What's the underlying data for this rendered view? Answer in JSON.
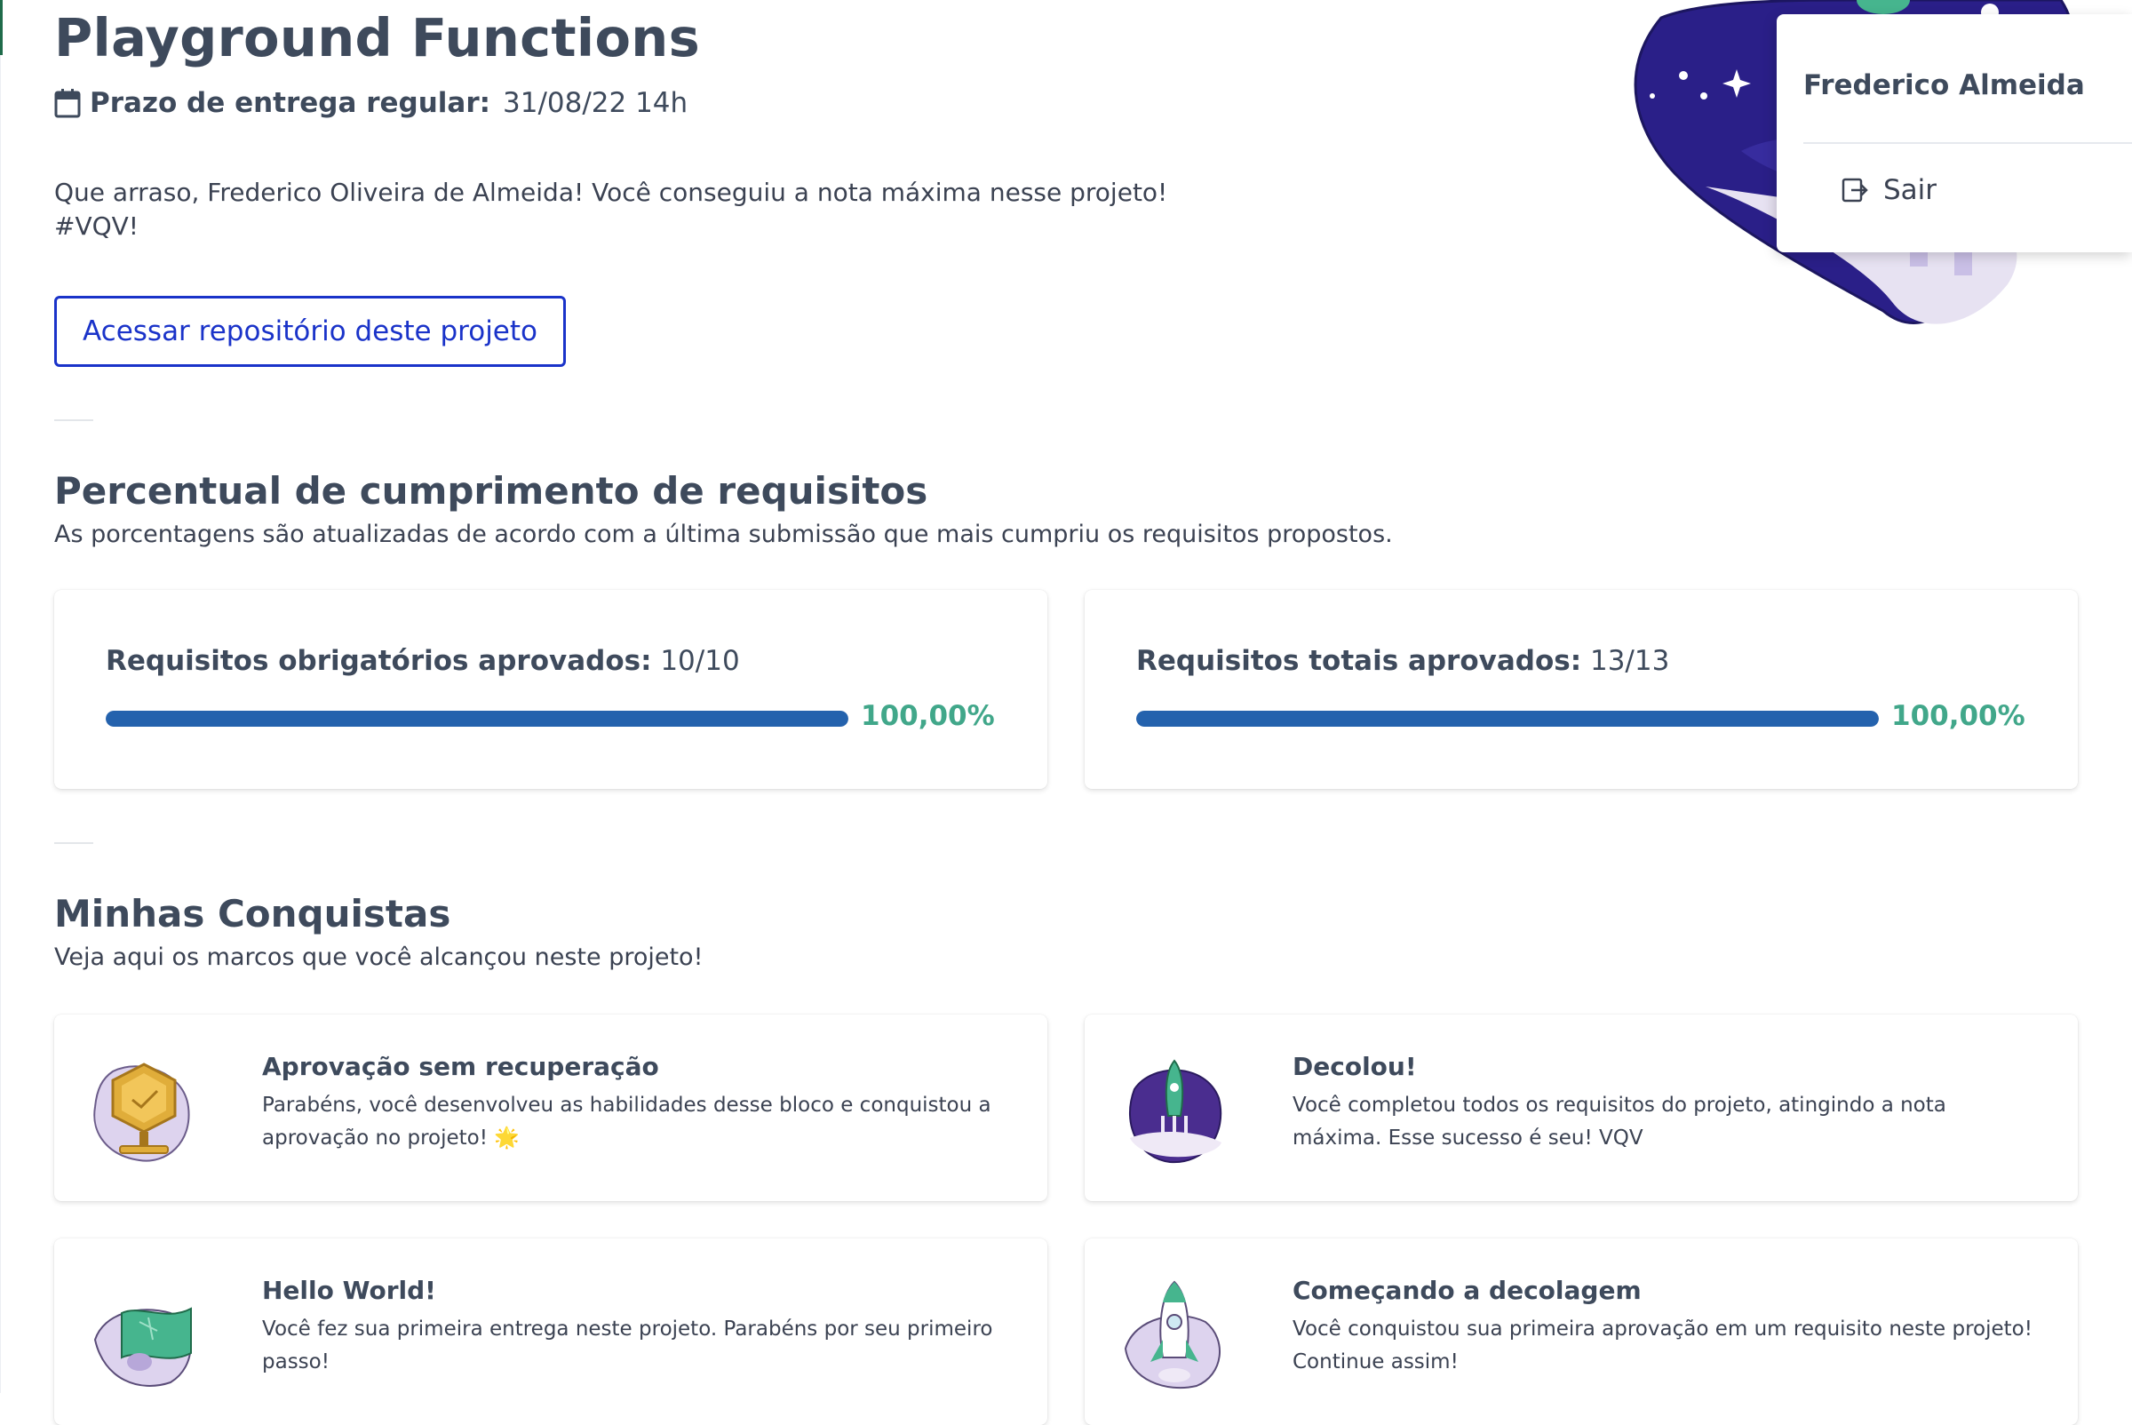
{
  "project": {
    "title": "Playground Functions",
    "deadline_label": "Prazo de entrega regular:",
    "deadline_value": "31/08/22 14h",
    "congrats_line1": "Que arraso, Frederico Oliveira de Almeida! Você conseguiu a nota máxima nesse projeto!",
    "congrats_line2": "#VQV!",
    "repo_button": "Acessar repositório deste projeto"
  },
  "user_menu": {
    "name": "Frederico Almeida",
    "logout_label": "Sair"
  },
  "requirements": {
    "title": "Percentual de cumprimento de requisitos",
    "subtitle": "As porcentagens são atualizadas de acordo com a última submissão que mais cumpriu os requisitos propostos.",
    "cards": [
      {
        "label": "Requisitos obrigatórios aprovados:",
        "value": "10/10",
        "percent_text": "100,00%",
        "progress": 1.0
      },
      {
        "label": "Requisitos totais aprovados:",
        "value": "13/13",
        "percent_text": "100,00%",
        "progress": 1.0
      }
    ]
  },
  "achievements": {
    "title": "Minhas Conquistas",
    "subtitle": "Veja aqui os marcos que você alcançou neste projeto!",
    "items": [
      {
        "title": "Aprovação sem recuperação",
        "description": "Parabéns, você desenvolveu as habilidades desse bloco e conquistou a aprovação no projeto! 🌟",
        "icon": "trophy-icon"
      },
      {
        "title": "Decolou!",
        "description": "Você completou todos os requisitos do projeto, atingindo a nota máxima. Esse sucesso é seu! VQV",
        "icon": "rocket-launch-icon"
      },
      {
        "title": "Hello World!",
        "description": "Você fez sua primeira entrega neste projeto. Parabéns por seu primeiro passo!",
        "icon": "flag-icon"
      },
      {
        "title": "Começando a decolagem",
        "description": "Você conquistou sua primeira aprovação em um requisito neste projeto! Continue assim!",
        "icon": "rocket-icon"
      }
    ]
  },
  "colors": {
    "accent_blue": "#1a33c9",
    "progress_blue": "#2462ad",
    "success_green": "#41a78a",
    "heading": "#3e4a5c"
  }
}
